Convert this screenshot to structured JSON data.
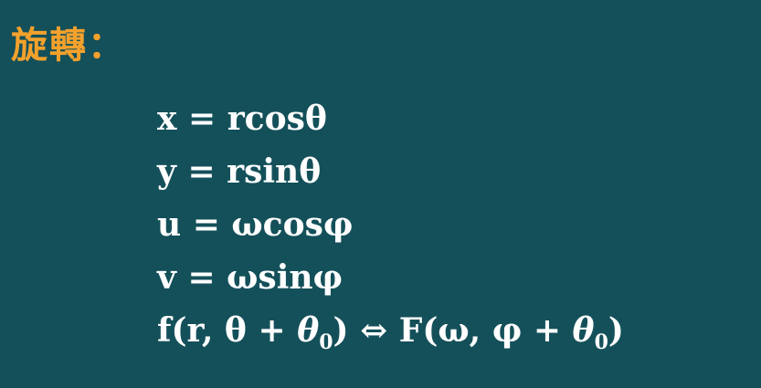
{
  "title": "旋轉：",
  "equations": [
    "x = rcosθ",
    "y = rsinθ",
    "u = ωcosφ",
    "v = ωsinφ"
  ],
  "transform_pair": {
    "lhs_open": "f(r, θ + ",
    "lhs_theta": "θ",
    "lhs_sub": "0",
    "lhs_close": ")",
    "arrow": " ⇔ ",
    "rhs_open": "F(ω, φ + ",
    "rhs_theta": "θ",
    "rhs_sub": "0",
    "rhs_close": ")"
  },
  "colors": {
    "background": "#14505a",
    "title": "#f4a12c",
    "text": "#ffffff"
  }
}
